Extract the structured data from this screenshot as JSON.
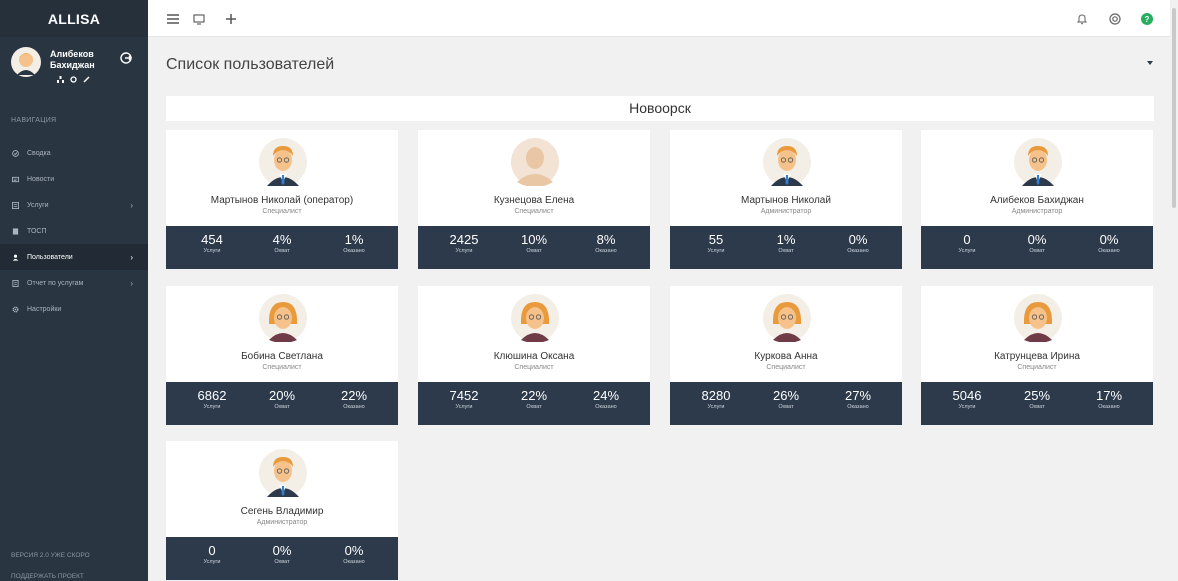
{
  "app": {
    "brand": "ALLISA"
  },
  "profile": {
    "name_line1": "Алибеков",
    "name_line2": "Бахиджан"
  },
  "nav": {
    "heading": "НАВИГАЦИЯ",
    "items": [
      {
        "label": "Сводка",
        "icon": "dashboard-icon",
        "chevron": ""
      },
      {
        "label": "Новости",
        "icon": "news-icon",
        "chevron": ""
      },
      {
        "label": "Услуги",
        "icon": "services-icon",
        "chevron": "›"
      },
      {
        "label": "ТОСП",
        "icon": "building-icon",
        "chevron": ""
      },
      {
        "label": "Пользователи",
        "icon": "users-icon",
        "chevron": "›",
        "active": true
      },
      {
        "label": "Отчет по услугам",
        "icon": "report-icon",
        "chevron": "›"
      },
      {
        "label": "Настройки",
        "icon": "settings-icon",
        "chevron": ""
      }
    ],
    "footer_version": "ВЕРСИЯ 2.0 УЖЕ СКОРО",
    "footer_support": "ПОДДЕРЖАТЬ ПРОЕКТ"
  },
  "page": {
    "title": "Список пользователей",
    "group": "Новоорск"
  },
  "stat_labels": {
    "services": "Услуги",
    "coverage": "Охват",
    "provided": "Оказано"
  },
  "users": [
    {
      "name": "Мартынов Николай (оператор)",
      "role": "Специалист",
      "avatar": "male",
      "services": "454",
      "coverage": "4%",
      "provided": "1%"
    },
    {
      "name": "Кузнецова Елена",
      "role": "Специалист",
      "avatar": "placeholder",
      "services": "2425",
      "coverage": "10%",
      "provided": "8%"
    },
    {
      "name": "Мартынов Николай",
      "role": "Администратор",
      "avatar": "male",
      "services": "55",
      "coverage": "1%",
      "provided": "0%"
    },
    {
      "name": "Алибеков Бахиджан",
      "role": "Администратор",
      "avatar": "male",
      "services": "0",
      "coverage": "0%",
      "provided": "0%"
    },
    {
      "name": "Бобина Светлана",
      "role": "Специалист",
      "avatar": "female",
      "services": "6862",
      "coverage": "20%",
      "provided": "22%"
    },
    {
      "name": "Клюшина Оксана",
      "role": "Специалист",
      "avatar": "female",
      "services": "7452",
      "coverage": "22%",
      "provided": "24%"
    },
    {
      "name": "Куркова Анна",
      "role": "Специалист",
      "avatar": "female",
      "services": "8280",
      "coverage": "26%",
      "provided": "27%"
    },
    {
      "name": "Катрунцева Ирина",
      "role": "Специалист",
      "avatar": "female",
      "services": "5046",
      "coverage": "25%",
      "provided": "17%"
    },
    {
      "name": "Сегень Владимир",
      "role": "Администратор",
      "avatar": "male",
      "services": "0",
      "coverage": "0%",
      "provided": "0%"
    }
  ],
  "colors": {
    "sidebar": "#2a3542",
    "stats_bar": "#2c3a4b",
    "help_badge": "#27ae60"
  }
}
